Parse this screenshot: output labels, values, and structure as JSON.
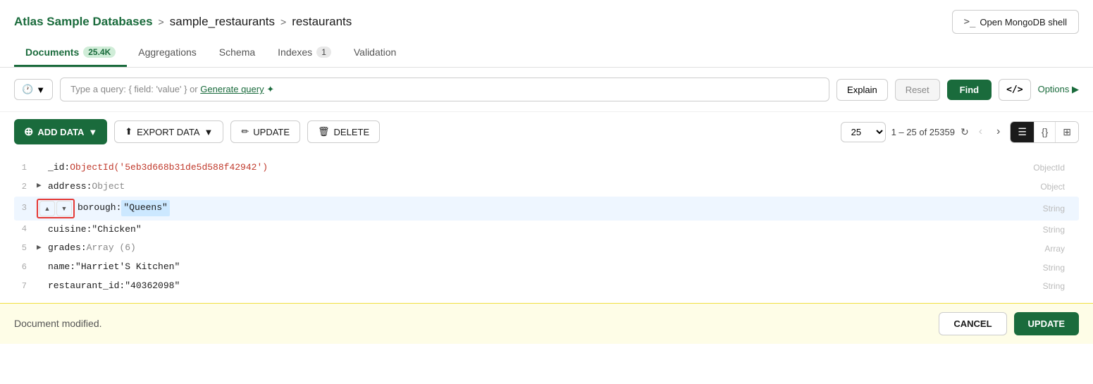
{
  "header": {
    "breadcrumb": {
      "part1": "Atlas Sample Databases",
      "sep1": ">",
      "part2": "sample_restaurants",
      "sep2": ">",
      "part3": "restaurants"
    },
    "open_shell_label": "Open MongoDB shell"
  },
  "tabs": [
    {
      "id": "documents",
      "label": "Documents",
      "badge": "25.4K",
      "active": true
    },
    {
      "id": "aggregations",
      "label": "Aggregations",
      "badge": null,
      "active": false
    },
    {
      "id": "schema",
      "label": "Schema",
      "badge": null,
      "active": false
    },
    {
      "id": "indexes",
      "label": "Indexes",
      "badge": "1",
      "active": false
    },
    {
      "id": "validation",
      "label": "Validation",
      "badge": null,
      "active": false
    }
  ],
  "query_bar": {
    "placeholder": "Type a query: { field: 'value' } or",
    "generate_query_link": "Generate query",
    "sparkle": "✦",
    "explain_label": "Explain",
    "reset_label": "Reset",
    "find_label": "Find",
    "code_label": "</>",
    "options_label": "Options ▶"
  },
  "toolbar": {
    "add_data_label": "ADD DATA",
    "export_data_label": "EXPORT DATA",
    "update_label": "UPDATE",
    "delete_label": "DELETE",
    "per_page": "25",
    "pagination_info": "1 – 25 of 25359",
    "prev_disabled": true,
    "next_disabled": false
  },
  "document": {
    "lines": [
      {
        "num": "1",
        "expand": "",
        "field": "_id",
        "colon": ":",
        "value": "ObjectId('5eb3d668b31de5d588f42942')",
        "value_class": "field-value-id",
        "type_label": "ObjectId",
        "highlighted": false
      },
      {
        "num": "2",
        "expand": "▶",
        "field": "address",
        "colon": ":",
        "value": "Object",
        "value_class": "field-value-type",
        "type_label": "Object",
        "highlighted": false
      },
      {
        "num": "3",
        "expand": "",
        "field": "borough",
        "colon": ":",
        "value": "\"Queens\"",
        "value_class": "field-value-string",
        "type_label": "String",
        "highlighted": true,
        "editable": true
      },
      {
        "num": "4",
        "expand": "",
        "field": "cuisine",
        "colon": ":",
        "value": "\"Chicken\"",
        "value_class": "field-value-string",
        "type_label": "String",
        "highlighted": false
      },
      {
        "num": "5",
        "expand": "▶",
        "field": "grades",
        "colon": ":",
        "value": "Array (6)",
        "value_class": "field-value-type",
        "type_label": "Array",
        "highlighted": false
      },
      {
        "num": "6",
        "expand": "",
        "field": "name",
        "colon": ":",
        "value": "\"Harriet'S Kitchen\"",
        "value_class": "field-value-string",
        "type_label": "String",
        "highlighted": false
      },
      {
        "num": "7",
        "expand": "",
        "field": "restaurant_id",
        "colon": ":",
        "value": "\"40362098\"",
        "value_class": "field-value-string",
        "type_label": "String",
        "highlighted": false
      }
    ]
  },
  "footer": {
    "message": "Document modified.",
    "cancel_label": "CANCEL",
    "update_label": "UPDATE"
  }
}
